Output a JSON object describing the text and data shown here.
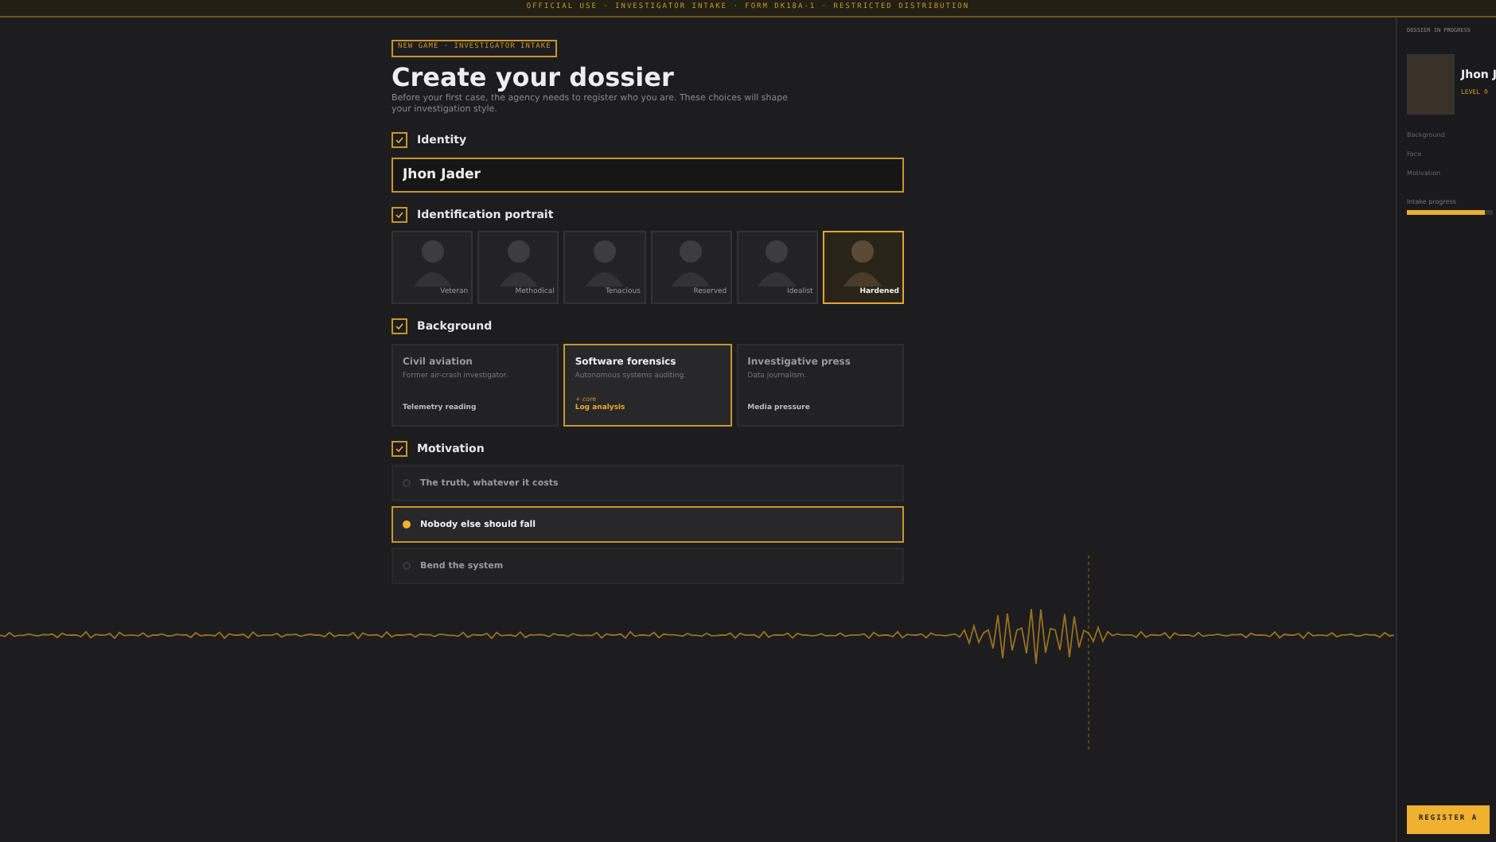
{
  "top_banner": "OFFICIAL USE · INVESTIGATOR INTAKE · FORM DK18A-1 · RESTRICTED DISTRIBUTION",
  "badge": "NEW GAME · INVESTIGATOR INTAKE",
  "title": "Create your dossier",
  "subtitle": "Before your first case, the agency needs to register who you are. These choices will shape your investigation style.",
  "identity": {
    "label": "Identity",
    "checked": true,
    "value": "Jhon Jader"
  },
  "portrait": {
    "label": "Identification portrait",
    "checked": true,
    "options": [
      {
        "trait": "Veteran",
        "selected": false
      },
      {
        "trait": "Methodical",
        "selected": false
      },
      {
        "trait": "Tenacious",
        "selected": false
      },
      {
        "trait": "Reserved",
        "selected": false
      },
      {
        "trait": "Idealist",
        "selected": false
      },
      {
        "trait": "Hardened",
        "selected": true
      }
    ]
  },
  "background": {
    "label": "Background",
    "checked": true,
    "options": [
      {
        "title": "Civil aviation",
        "description": "Former air-crash investigator.",
        "skill": "Telemetry reading",
        "selected": false
      },
      {
        "title": "Software forensics",
        "description": "Autonomous systems auditing.",
        "tag": "+ core",
        "skill": "Log analysis",
        "selected": true
      },
      {
        "title": "Investigative press",
        "description": "Data journalism.",
        "skill": "Media pressure",
        "selected": false
      }
    ]
  },
  "motivation": {
    "label": "Motivation",
    "checked": true,
    "options": [
      {
        "title": "The truth, whatever it costs",
        "selected": false
      },
      {
        "title": "Nobody else should fall",
        "selected": true
      },
      {
        "title": "Bend the system",
        "selected": false
      }
    ]
  },
  "sidebar": {
    "heading": "DOSSIER IN PROGRESS",
    "name": "Jhon J",
    "level": "LEVEL 0",
    "fields": [
      "Background",
      "Face",
      "Motivation"
    ],
    "progress_label": "Intake progress",
    "progress": {
      "level": 0.9
    },
    "register_button": "REGISTER A"
  }
}
